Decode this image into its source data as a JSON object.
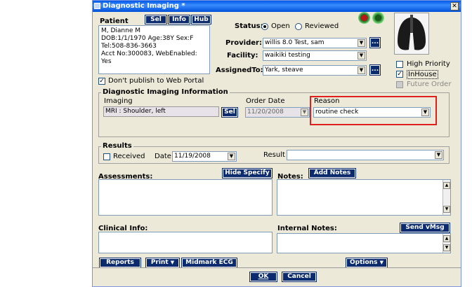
{
  "window": {
    "title": "Diagnostic Imaging *",
    "close": "✕"
  },
  "patient": {
    "label": "Patient",
    "sel": "Sel",
    "info": "Info",
    "hub": "Hub",
    "lines": [
      "M, Dianne M",
      "DOB:1/1/1970  Age:38Y  Sex:F",
      "Tel:508-836-3663",
      "Acct No:300083, WebEnabled:",
      "Yes"
    ]
  },
  "status": {
    "label": "Status:",
    "open": "Open",
    "reviewed": "Reviewed",
    "selected": "Open"
  },
  "provider": {
    "label": "Provider:",
    "value": "willis 8.0 Test, sam"
  },
  "facility": {
    "label": "Facility:",
    "value": "waikiki testing"
  },
  "assigned": {
    "label": "AssignedTo:",
    "value": "Yark, steave"
  },
  "dots": "...",
  "flags": {
    "high_priority": {
      "label": "High Priority",
      "checked": false
    },
    "inhouse": {
      "label": "InHouse",
      "checked": true
    },
    "future_order": {
      "label": "Future Order",
      "checked": false
    }
  },
  "dont_publish": {
    "label": "Don't publish to Web Portal",
    "checked": true
  },
  "imaging_info": {
    "legend": "Diagnostic Imaging Information",
    "imaging_label": "Imaging",
    "imaging_value": "MRI : Shoulder, left",
    "sel": "Sel",
    "order_date_label": "Order Date",
    "order_date_value": "11/20/2008",
    "reason_label": "Reason",
    "reason_value": "routine check"
  },
  "results": {
    "legend": "Results",
    "received_label": "Received",
    "date_label": "Date",
    "date_value": "11/19/2008",
    "result_label": "Result",
    "result_value": ""
  },
  "assessments": {
    "label": "Assessments:",
    "hide_specify": "Hide Specify"
  },
  "notes": {
    "label": "Notes:",
    "add_notes": "Add Notes"
  },
  "clinical_info": {
    "label": "Clinical Info:"
  },
  "internal_notes": {
    "label": "Internal Notes:",
    "send_vmsg": "Send vMsg"
  },
  "footer": {
    "reports": "Reports",
    "print": "Print",
    "midmark": "Midmark ECG",
    "options": "Options",
    "ok": "OK",
    "cancel": "Cancel"
  }
}
